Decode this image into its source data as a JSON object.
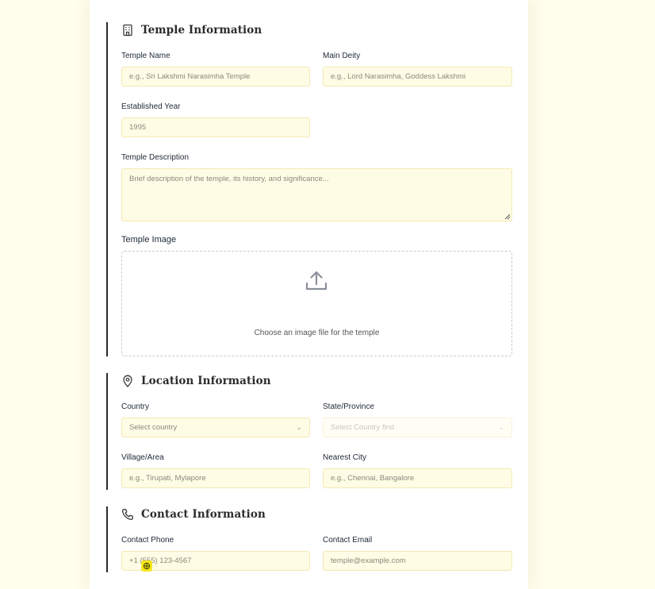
{
  "temple_info": {
    "title": "Temple Information",
    "icon": "building-icon",
    "temple_name": {
      "label": "Temple Name",
      "placeholder": "e.g., Sri Lakshmi Narasimha Temple"
    },
    "main_deity": {
      "label": "Main Deity",
      "placeholder": "e.g., Lord Narasimha, Goddess Lakshmi"
    },
    "established_year": {
      "label": "Established Year",
      "placeholder": "1995"
    },
    "description": {
      "label": "Temple Description",
      "placeholder": "Brief description of the temple, its history, and significance..."
    },
    "image": {
      "label": "Temple Image",
      "hint": "Choose an image file for the temple",
      "icon": "upload-icon"
    }
  },
  "location_info": {
    "title": "Location Information",
    "icon": "map-pin-icon",
    "country": {
      "label": "Country",
      "value": "Select country"
    },
    "state": {
      "label": "State/Province",
      "value": "Select Country first"
    },
    "village": {
      "label": "Village/Area",
      "placeholder": "e.g., Tirupati, Mylapore"
    },
    "city": {
      "label": "Nearest City",
      "placeholder": "e.g., Chennai, Bangalore"
    }
  },
  "contact_info": {
    "title": "Contact Information",
    "icon": "phone-icon",
    "phone": {
      "label": "Contact Phone",
      "placeholder": "+1 (555) 123-4567"
    },
    "email": {
      "label": "Contact Email",
      "placeholder": "temple@example.com"
    }
  },
  "colors": {
    "page_bg": "#fffdeb",
    "field_bg": "#fffce6",
    "field_border": "#f3e9b3",
    "section_rule": "#2a2a2a",
    "cursor_highlight": "#f4e61c"
  }
}
